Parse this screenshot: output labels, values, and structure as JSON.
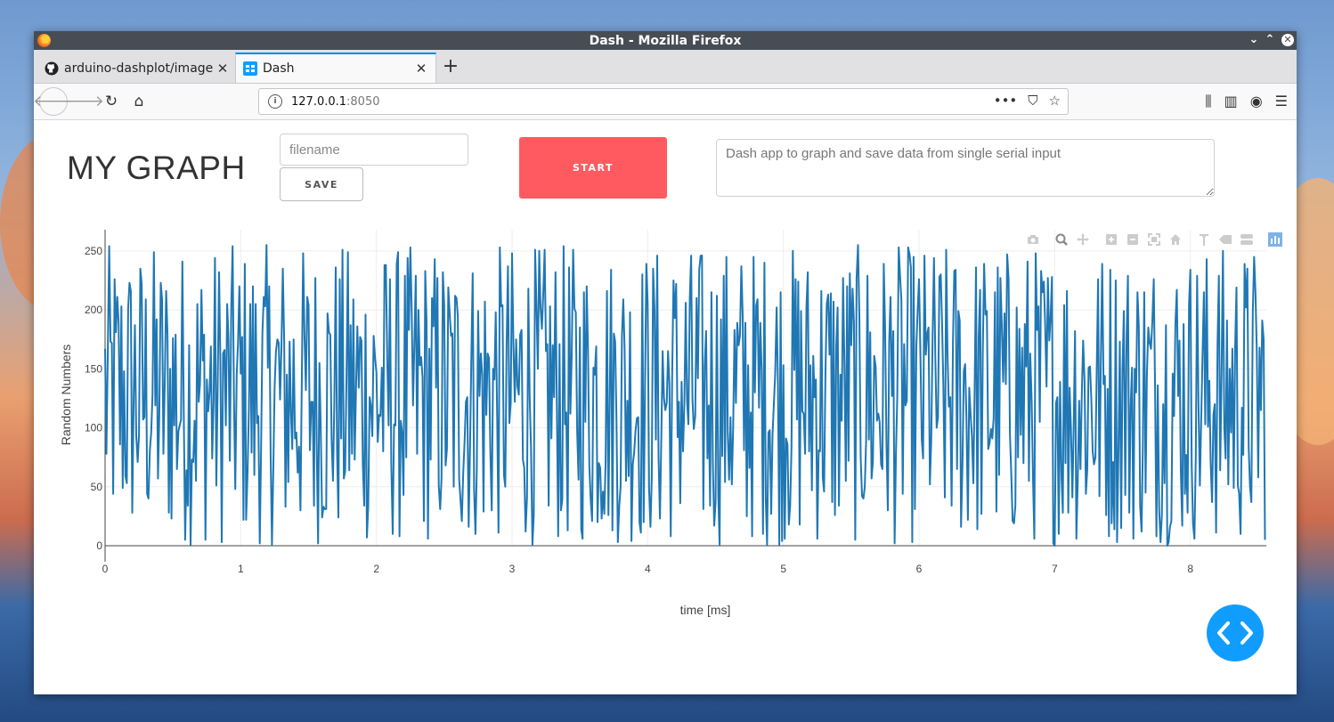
{
  "window": {
    "title": "Dash - Mozilla Firefox",
    "controls": [
      "chevron-down",
      "chevron-up",
      "close"
    ]
  },
  "tabs": [
    {
      "label": "arduino-dashplot/image",
      "icon": "github-icon",
      "active": false
    },
    {
      "label": "Dash",
      "icon": "dash-favicon",
      "active": true
    }
  ],
  "nav": {
    "url_host": "127.0.0.1",
    "url_port": ":8050"
  },
  "app": {
    "title": "MY GRAPH",
    "filename_placeholder": "filename",
    "filename_value": "",
    "save_label": "SAVE",
    "start_label": "START",
    "start_color": "#ff5a5f",
    "notes_placeholder": "Dash app to graph and save data from single serial input"
  },
  "modebar": [
    "camera-icon",
    "zoom-icon",
    "pan-icon",
    "zoom-in-icon",
    "zoom-out-icon",
    "autoscale-icon",
    "reset-axes-icon",
    "spike-lines-icon",
    "hover-closest-icon",
    "hover-compare-icon",
    "plotly-logo-icon"
  ],
  "chart_data": {
    "type": "line",
    "xlabel": "time [ms]",
    "ylabel": "Random Numbers",
    "xlim": [
      0,
      8.56
    ],
    "ylim": [
      0,
      268
    ],
    "xticks": [
      0,
      1,
      2,
      3,
      4,
      5,
      6,
      7,
      8
    ],
    "yticks": [
      0,
      50,
      100,
      150,
      200,
      250
    ],
    "series": [
      {
        "color": "#1f77b4",
        "generation_note": "random integer values 0-255, one sample every 0.01 ms",
        "samples": 856,
        "x_step": 0.01,
        "value_range": [
          0,
          255
        ]
      }
    ],
    "grid": true,
    "legend": false
  }
}
